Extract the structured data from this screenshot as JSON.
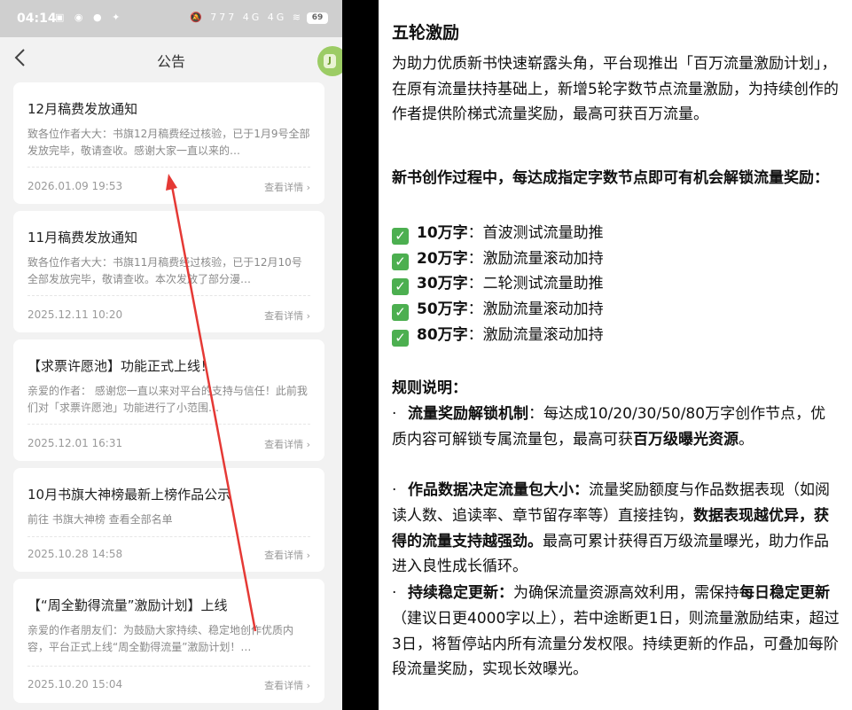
{
  "status_bar": {
    "time": "04:14",
    "left_icons": "▣ ◉ ● ✦",
    "right_icons": "🔕 777 4G 4G ≋ ",
    "battery": "69"
  },
  "nav": {
    "title": "公告",
    "avatar_glyph": "J"
  },
  "announcements": [
    {
      "title": "12月稿费发放通知",
      "body": "致各位作者大大：书旗12月稿费经过核验，已于1月9号全部发放完毕，敬请查收。感谢大家一直以来的…",
      "date": "2026.01.09 19:53",
      "more": "查看详情 ›"
    },
    {
      "title": "11月稿费发放通知",
      "body": "致各位作者大大：书旗11月稿费经过核验，已于12月10号全部发放完毕，敬请查收。本次发放了部分漫…",
      "date": "2025.12.11 10:20",
      "more": "查看详情 ›"
    },
    {
      "title": "【求票许愿池】功能正式上线！",
      "body": "亲爱的作者：  感谢您一直以来对平台的支持与信任！此前我们对「求票许愿池」功能进行了小范围…",
      "date": "2025.12.01 16:31",
      "more": "查看详情 ›"
    },
    {
      "title": "10月书旗大神榜最新上榜作品公示",
      "body": "前往 书旗大神榜 查看全部名单",
      "date": "2025.10.28 14:58",
      "more": "查看详情 ›"
    },
    {
      "title": "【“周全勤得流量”激励计划】上线",
      "body": "亲爱的作者朋友们：为鼓励大家持续、稳定地创作优质内容，平台正式上线“周全勤得流量”激励计划！…",
      "date": "2025.10.20 15:04",
      "more": "查看详情 ›"
    }
  ],
  "article": {
    "title": "五轮激励",
    "intro": "为助力优质新书快速崭露头角，平台现推出「百万流量激励计划」，在原有流量扶持基础上，新增5轮字数节点流量激励，为持续创作的作者提供阶梯式流量奖励，最高可获百万流量。",
    "milestone_heading": "新书创作过程中，每达成指定字数节点即可有机会解锁流量奖励：",
    "milestones": [
      {
        "amount": "10万字",
        "sep": "：",
        "reward": "首波测试流量助推"
      },
      {
        "amount": "20万字",
        "sep": "：",
        "reward": "激励流量滚动加持"
      },
      {
        "amount": "30万字",
        "sep": "：",
        "reward": "二轮测试流量助推"
      },
      {
        "amount": "50万字",
        "sep": "：",
        "reward": "激励流量滚动加持"
      },
      {
        "amount": "80万字",
        "sep": "：",
        "reward": "激励流量滚动加持"
      }
    ],
    "rules_heading": "规则说明：",
    "rules": [
      {
        "bullet": "·",
        "lead": "流量奖励解锁机制",
        "text1": "：每达成10/20/30/50/80万字创作节点，优质内容可解锁专属流量包，最高可获",
        "bold2": "百万级曝光资源",
        "text2": "。"
      },
      {
        "bullet": "·",
        "lead": "作品数据决定流量包大小：",
        "text1": "流量奖励额度与作品数据表现（如阅读人数、追读率、章节留存率等）直接挂钩，",
        "bold2": "数据表现越优异，获得的流量支持越强劲。",
        "text2": "最高可累计获得百万级流量曝光，助力作品进入良性成长循环。"
      },
      {
        "bullet": "·",
        "lead": "持续稳定更新：",
        "text1": "为确保流量资源高效利用，需保持",
        "bold2": "每日稳定更新",
        "text2": "（建议日更4000字以上），若中途断更1日，则流量激励结束，超过3日，将暂停站内所有流量分发权限。持续更新的作品，可叠加每阶段流量奖励，实现长效曝光。"
      }
    ]
  }
}
